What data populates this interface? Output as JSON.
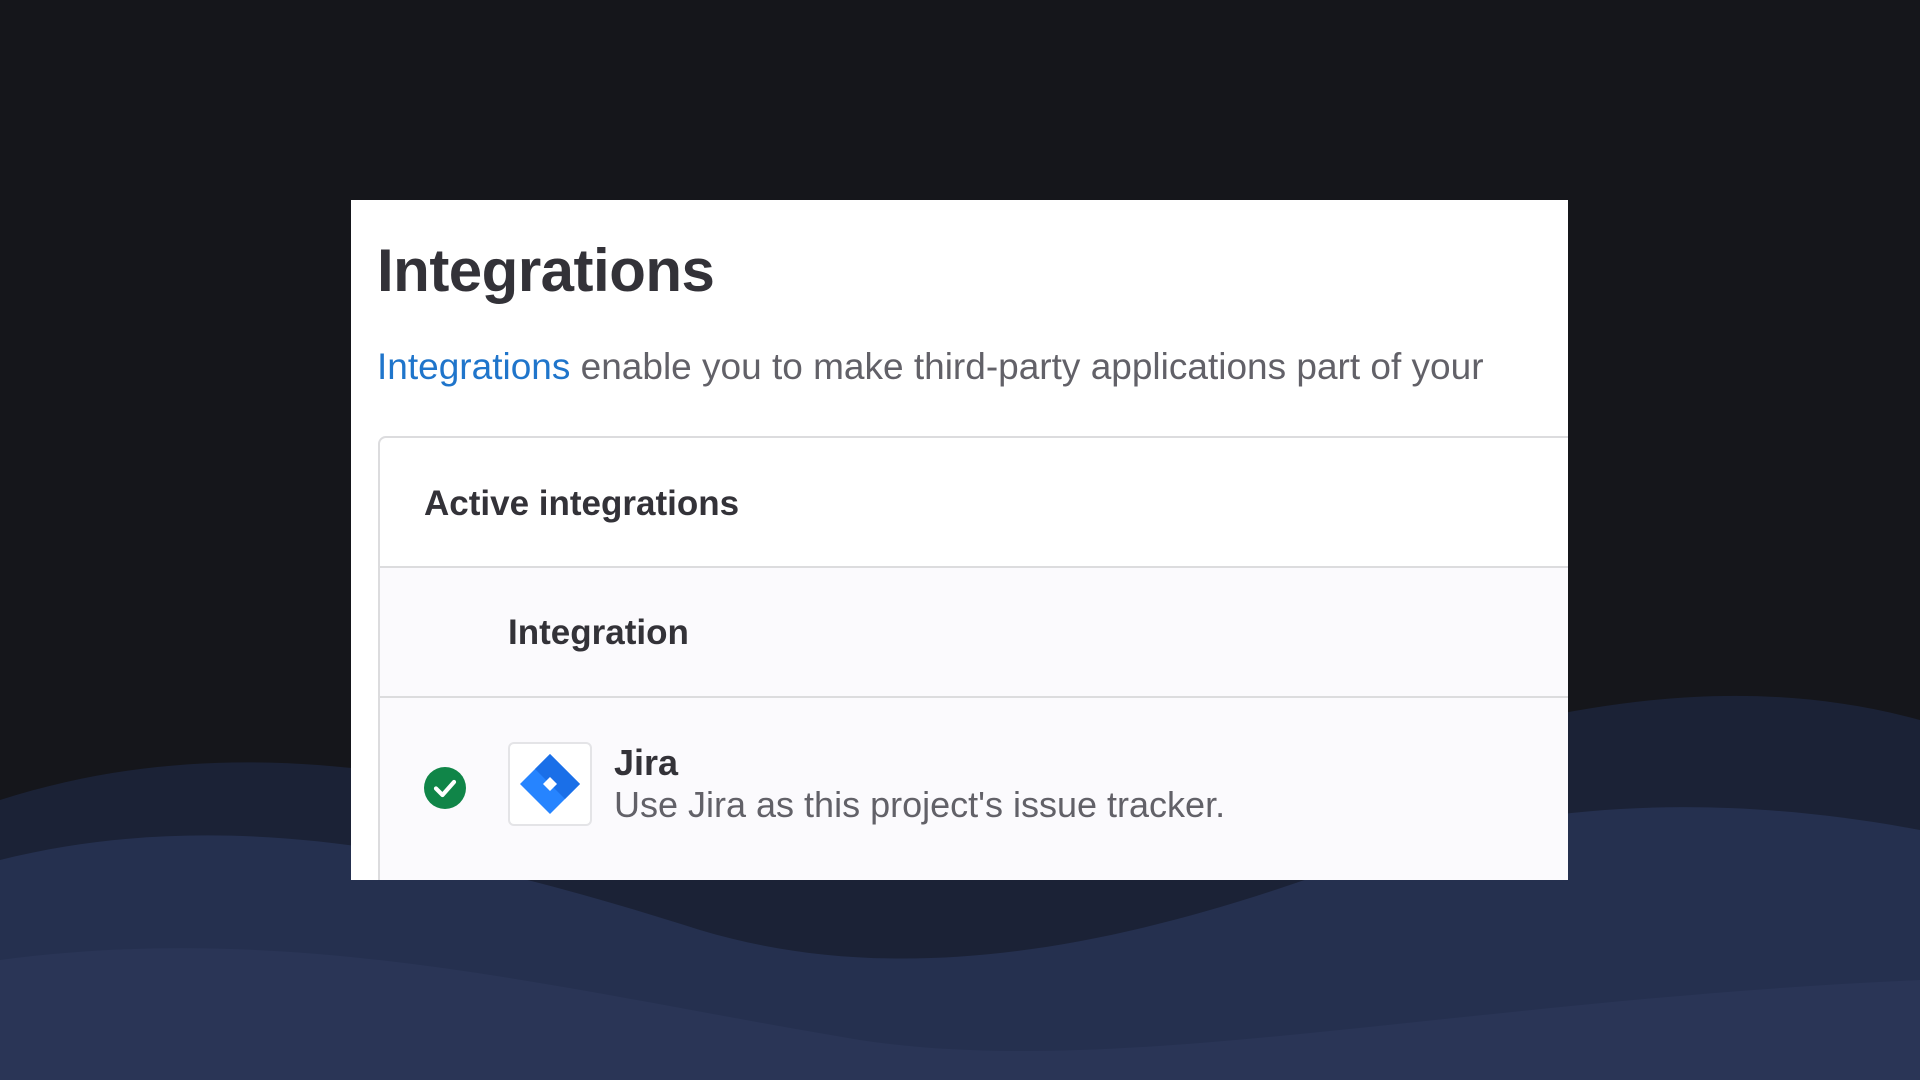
{
  "page": {
    "title": "Integrations",
    "intro": {
      "link_text": "Integrations",
      "text": " enable you to make third-party applications part of your"
    }
  },
  "active_integrations": {
    "title": "Active integrations",
    "columns": [
      "Integration"
    ],
    "rows": [
      {
        "status": "active",
        "status_icon": "check-circle-icon",
        "logo_icon": "jira-logo-icon",
        "name": "Jira",
        "description": "Use Jira as this project's issue tracker."
      }
    ]
  },
  "colors": {
    "link": "#1f75cb",
    "success": "#108548",
    "jira_brand": "#2684ff"
  }
}
